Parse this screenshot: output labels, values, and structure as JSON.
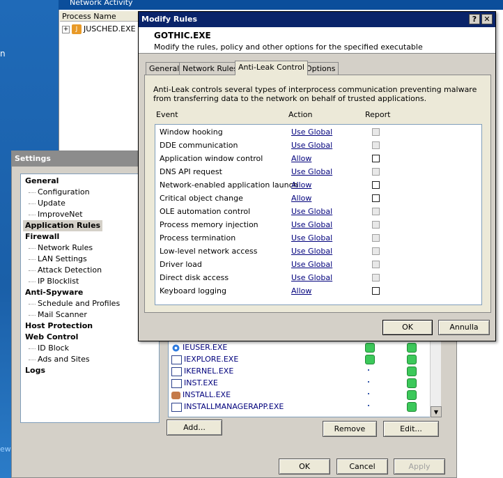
{
  "background": {
    "title": "Network Activity",
    "process_header": "Process Name",
    "process_row": "JUSCHED.EXE"
  },
  "settings": {
    "title": "Settings",
    "tree": [
      {
        "label": "General",
        "type": "cat"
      },
      {
        "label": "Configuration",
        "type": "sub"
      },
      {
        "label": "Update",
        "type": "sub"
      },
      {
        "label": "ImproveNet",
        "type": "sub"
      },
      {
        "label": "Application Rules",
        "type": "cat",
        "selected": true
      },
      {
        "label": "Firewall",
        "type": "cat"
      },
      {
        "label": "Network Rules",
        "type": "sub"
      },
      {
        "label": "LAN Settings",
        "type": "sub"
      },
      {
        "label": "Attack Detection",
        "type": "sub"
      },
      {
        "label": "IP Blocklist",
        "type": "sub"
      },
      {
        "label": "Anti-Spyware",
        "type": "cat"
      },
      {
        "label": "Schedule and Profiles",
        "type": "sub"
      },
      {
        "label": "Mail Scanner",
        "type": "sub"
      },
      {
        "label": "Host Protection",
        "type": "cat"
      },
      {
        "label": "Web Control",
        "type": "cat"
      },
      {
        "label": "ID Block",
        "type": "sub"
      },
      {
        "label": "Ads and Sites",
        "type": "sub"
      },
      {
        "label": "Logs",
        "type": "cat"
      }
    ],
    "processes": [
      {
        "name": "IEUSER.EXE",
        "icon": "ie-icon",
        "status1": "green",
        "status2": "green"
      },
      {
        "name": "IEXPLORE.EXE",
        "icon": "window-icon",
        "status1": "green",
        "status2": "green"
      },
      {
        "name": "IKERNEL.EXE",
        "icon": "window-icon",
        "status1": "dot",
        "status2": "green"
      },
      {
        "name": "INST.EXE",
        "icon": "window-icon",
        "status1": "dot",
        "status2": "green"
      },
      {
        "name": "INSTALL.EXE",
        "icon": "installer-icon",
        "status1": "dot",
        "status2": "green"
      },
      {
        "name": "INSTALLMANAGERAPP.EXE",
        "icon": "window-icon",
        "status1": "dot",
        "status2": "green"
      }
    ],
    "buttons": {
      "add": "Add...",
      "remove": "Remove",
      "edit": "Edit...",
      "ok": "OK",
      "cancel": "Cancel",
      "apply": "Apply"
    }
  },
  "modify": {
    "title": "Modify Rules",
    "help_label": "?",
    "close_label": "✕",
    "exe_name": "GOTHIC.EXE",
    "description": "Modify the rules, policy and other options for the specified executable",
    "tabs": [
      "General",
      "Network Rules",
      "Anti-Leak Control",
      "Options"
    ],
    "active_tab": 2,
    "panel_description": "Anti-Leak controls several types of interprocess communication preventing malware from transferring data to the network on behalf of trusted applications.",
    "columns": {
      "event": "Event",
      "action": "Action",
      "report": "Report"
    },
    "events": [
      {
        "event": "Window hooking",
        "action": "Use Global",
        "report_disabled": true
      },
      {
        "event": "DDE communication",
        "action": "Use Global",
        "report_disabled": true
      },
      {
        "event": "Application window control",
        "action": "Allow",
        "report_disabled": false
      },
      {
        "event": "DNS API request",
        "action": "Use Global",
        "report_disabled": true
      },
      {
        "event": "Network-enabled application launch",
        "action": "Allow",
        "report_disabled": false
      },
      {
        "event": "Critical object change",
        "action": "Allow",
        "report_disabled": false
      },
      {
        "event": "OLE automation control",
        "action": "Use Global",
        "report_disabled": true
      },
      {
        "event": "Process memory injection",
        "action": "Use Global",
        "report_disabled": true
      },
      {
        "event": "Process termination",
        "action": "Use Global",
        "report_disabled": true
      },
      {
        "event": "Low-level network access",
        "action": "Use Global",
        "report_disabled": true
      },
      {
        "event": "Driver load",
        "action": "Use Global",
        "report_disabled": true
      },
      {
        "event": "Direct disk access",
        "action": "Use Global",
        "report_disabled": true
      },
      {
        "event": "Keyboard logging",
        "action": "Allow",
        "report_disabled": false
      }
    ],
    "buttons": {
      "ok": "OK",
      "cancel": "Annulla"
    }
  }
}
